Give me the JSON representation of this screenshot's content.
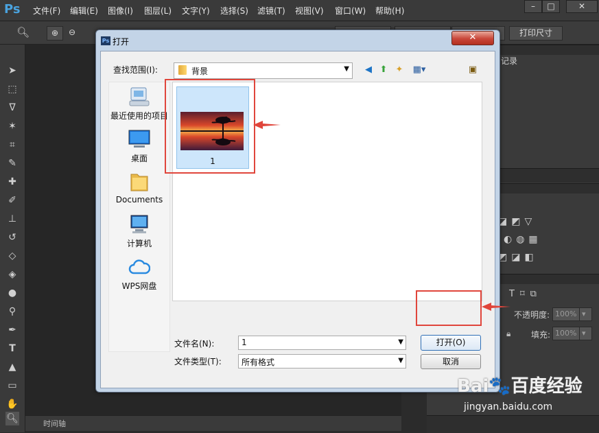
{
  "app": {
    "logo": "Ps",
    "menu": [
      "文件(F)",
      "编辑(E)",
      "图像(I)",
      "图层(L)",
      "文字(Y)",
      "选择(S)",
      "滤镜(T)",
      "视图(V)",
      "窗口(W)",
      "帮助(H)"
    ],
    "window_controls": [
      "–",
      "□",
      "✕"
    ],
    "options_bar": {
      "print_size_button": "打印尺寸"
    },
    "timeline_label": "时间轴",
    "right_panel": {
      "history_tab": "记录",
      "opacity_label": "不透明度:",
      "opacity_value": "100%",
      "fill_label": "填充:",
      "fill_value": "100%"
    }
  },
  "dialog": {
    "title": "打开",
    "title_icon": "Ps",
    "close": "✕",
    "look_in_label": "查找范围(I):",
    "look_in_value": "背景",
    "places": [
      {
        "label": "最近使用的项目",
        "icon": "recent-icon"
      },
      {
        "label": "桌面",
        "icon": "desktop-icon"
      },
      {
        "label": "Documents",
        "icon": "folder-icon"
      },
      {
        "label": "计算机",
        "icon": "computer-icon"
      },
      {
        "label": "WPS网盘",
        "icon": "cloud-icon"
      }
    ],
    "files": [
      {
        "name": "1"
      }
    ],
    "filename_label": "文件名(N):",
    "filename_value": "1",
    "filetype_label": "文件类型(T):",
    "filetype_value": "所有格式",
    "open_button": "打开(O)",
    "cancel_button": "取消"
  },
  "watermark": {
    "logo": "Bai🐾百度",
    "brand": "经验",
    "url": "jingyan.baidu.com"
  },
  "colors": {
    "highlight": "#e0453b",
    "accent": "#2f6fb6"
  }
}
